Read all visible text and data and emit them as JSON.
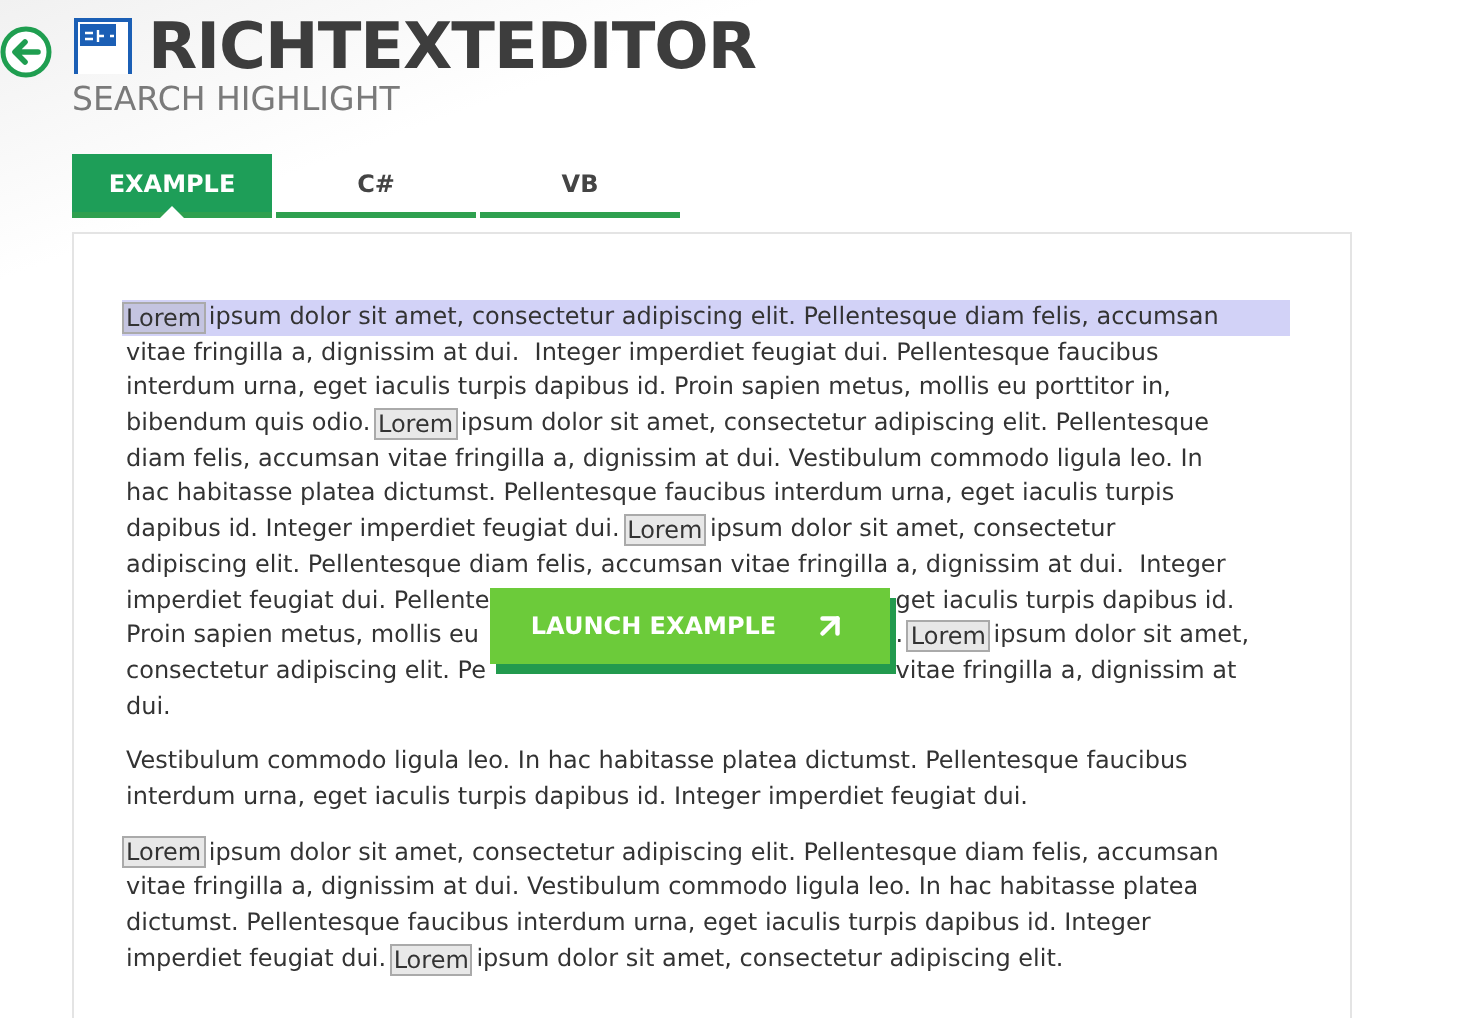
{
  "header": {
    "title": "RICHTEXTEDITOR",
    "subtitle": "SEARCH HIGHLIGHT"
  },
  "tabs": [
    {
      "label": "EXAMPLE",
      "selected": true
    },
    {
      "label": "C#",
      "selected": false
    },
    {
      "label": "VB",
      "selected": false
    }
  ],
  "launch_button": {
    "label": "LAUNCH EXAMPLE"
  },
  "paragraphs": [
    {
      "lines": [
        {
          "kind": "line",
          "selected": true,
          "segments": [
            {
              "kind": "match",
              "text": "Lorem"
            },
            {
              "kind": "text",
              "text": " ipsum dolor sit amet, consectetur adipiscing elit. Pellentesque diam felis, accumsan"
            }
          ]
        },
        {
          "kind": "line",
          "selected": false,
          "segments": [
            {
              "kind": "text",
              "text": "vitae fringilla a, dignissim at dui.  Integer imperdiet feugiat dui. Pellentesque faucibus"
            }
          ]
        },
        {
          "kind": "line",
          "selected": false,
          "segments": [
            {
              "kind": "text",
              "text": "interdum urna, eget iaculis turpis dapibus id. Proin sapien metus, mollis eu porttitor in,"
            }
          ]
        },
        {
          "kind": "line",
          "selected": false,
          "segments": [
            {
              "kind": "text",
              "text": "bibendum quis odio. "
            },
            {
              "kind": "match",
              "text": "Lorem"
            },
            {
              "kind": "text",
              "text": " ipsum dolor sit amet, consectetur adipiscing elit. Pellentesque"
            }
          ]
        },
        {
          "kind": "line",
          "selected": false,
          "segments": [
            {
              "kind": "text",
              "text": "diam felis, accumsan vitae fringilla a, dignissim at dui. Vestibulum commodo ligula leo. In"
            }
          ]
        },
        {
          "kind": "line",
          "selected": false,
          "segments": [
            {
              "kind": "text",
              "text": "hac habitasse platea dictumst. Pellentesque faucibus interdum urna, eget iaculis turpis"
            }
          ]
        },
        {
          "kind": "line",
          "selected": false,
          "segments": [
            {
              "kind": "text",
              "text": "dapibus id. Integer imperdiet feugiat dui. "
            },
            {
              "kind": "match",
              "text": "Lorem"
            },
            {
              "kind": "text",
              "text": " ipsum dolor sit amet, consectetur"
            }
          ]
        },
        {
          "kind": "line",
          "selected": false,
          "segments": [
            {
              "kind": "text",
              "text": "adipiscing elit. Pellentesque diam felis, accumsan vitae fringilla a, dignissim at dui.  Integer"
            }
          ]
        },
        {
          "kind": "split",
          "selected": false,
          "left": [
            {
              "kind": "text",
              "text": "imperdiet feugiat dui. Pellente"
            }
          ],
          "right": [
            {
              "kind": "text",
              "text": "get iaculis turpis dapibus id."
            }
          ]
        },
        {
          "kind": "split",
          "selected": false,
          "left": [
            {
              "kind": "text",
              "text": "Proin sapien metus, mollis eu"
            }
          ],
          "right": [
            {
              "kind": "text",
              "text": ". "
            },
            {
              "kind": "match",
              "text": "Lorem"
            },
            {
              "kind": "text",
              "text": " ipsum dolor sit amet,"
            }
          ]
        },
        {
          "kind": "split",
          "selected": false,
          "left": [
            {
              "kind": "text",
              "text": "consectetur adipiscing elit. Pe"
            }
          ],
          "right": [
            {
              "kind": "text",
              "text": "vitae fringilla a, dignissim at"
            }
          ]
        },
        {
          "kind": "line",
          "selected": false,
          "segments": [
            {
              "kind": "text",
              "text": "dui."
            }
          ]
        }
      ]
    },
    {
      "lines": [
        {
          "kind": "line",
          "selected": false,
          "segments": [
            {
              "kind": "text",
              "text": "Vestibulum commodo ligula leo. In hac habitasse platea dictumst. Pellentesque faucibus"
            }
          ]
        },
        {
          "kind": "line",
          "selected": false,
          "segments": [
            {
              "kind": "text",
              "text": "interdum urna, eget iaculis turpis dapibus id. Integer imperdiet feugiat dui."
            }
          ]
        }
      ]
    },
    {
      "lines": [
        {
          "kind": "line",
          "selected": false,
          "segments": [
            {
              "kind": "match",
              "text": "Lorem"
            },
            {
              "kind": "text",
              "text": " ipsum dolor sit amet, consectetur adipiscing elit. Pellentesque diam felis, accumsan"
            }
          ]
        },
        {
          "kind": "line",
          "selected": false,
          "segments": [
            {
              "kind": "text",
              "text": "vitae fringilla a, dignissim at dui. Vestibulum commodo ligula leo. In hac habitasse platea"
            }
          ]
        },
        {
          "kind": "line",
          "selected": false,
          "segments": [
            {
              "kind": "text",
              "text": "dictumst. Pellentesque faucibus interdum urna, eget iaculis turpis dapibus id. Integer"
            }
          ]
        },
        {
          "kind": "line",
          "selected": false,
          "segments": [
            {
              "kind": "text",
              "text": "imperdiet feugiat dui. "
            },
            {
              "kind": "match",
              "text": "Lorem"
            },
            {
              "kind": "text",
              "text": " ipsum dolor sit amet, consectetur adipiscing elit."
            }
          ]
        }
      ]
    }
  ]
}
